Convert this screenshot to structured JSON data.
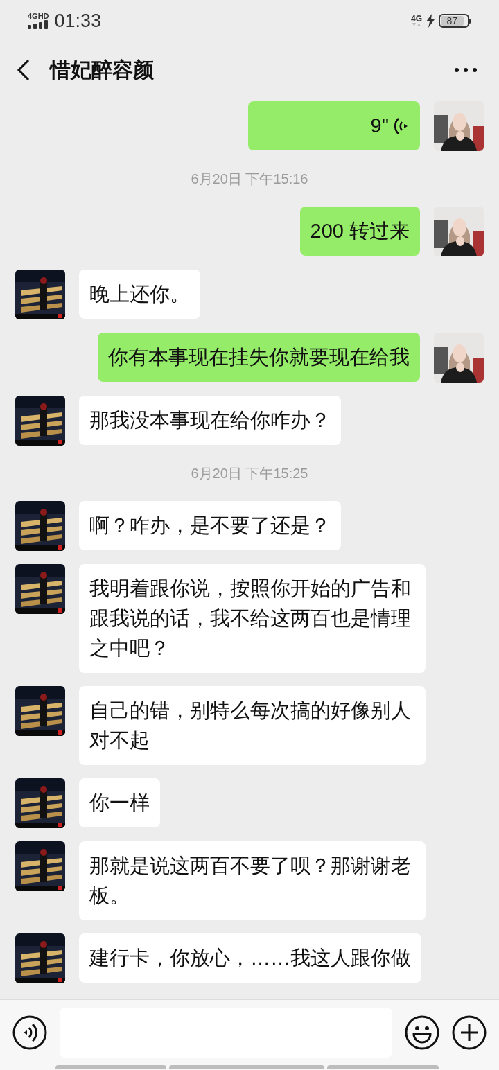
{
  "status_bar": {
    "network_left": "4GHD",
    "time": "01:33",
    "network_right": "4G",
    "battery": "87"
  },
  "header": {
    "title": "惜妃醉容颜"
  },
  "messages": [
    {
      "kind": "voice",
      "sent": true,
      "duration": "9\""
    },
    {
      "kind": "time",
      "text": "6月20日 下午15:16"
    },
    {
      "kind": "text",
      "sent": true,
      "text": "200 转过来"
    },
    {
      "kind": "text",
      "sent": false,
      "text": "晚上还你。"
    },
    {
      "kind": "text",
      "sent": true,
      "text": "你有本事现在挂失你就要现在给我"
    },
    {
      "kind": "text",
      "sent": false,
      "text": "那我没本事现在给你咋办？"
    },
    {
      "kind": "time",
      "text": "6月20日 下午15:25"
    },
    {
      "kind": "text",
      "sent": false,
      "text": "啊？咋办，是不要了还是？"
    },
    {
      "kind": "text",
      "sent": false,
      "text": "我明着跟你说，按照你开始的广告和跟我说的话，我不给这两百也是情理之中吧？"
    },
    {
      "kind": "text",
      "sent": false,
      "text": "自己的错，别特么每次搞的好像别人对不起"
    },
    {
      "kind": "text",
      "sent": false,
      "text": "你一样"
    },
    {
      "kind": "text",
      "sent": false,
      "text": "那就是说这两百不要了呗？那谢谢老板。"
    },
    {
      "kind": "text",
      "sent": false,
      "text": "建行卡，你放心，……我这人跟你做"
    }
  ]
}
